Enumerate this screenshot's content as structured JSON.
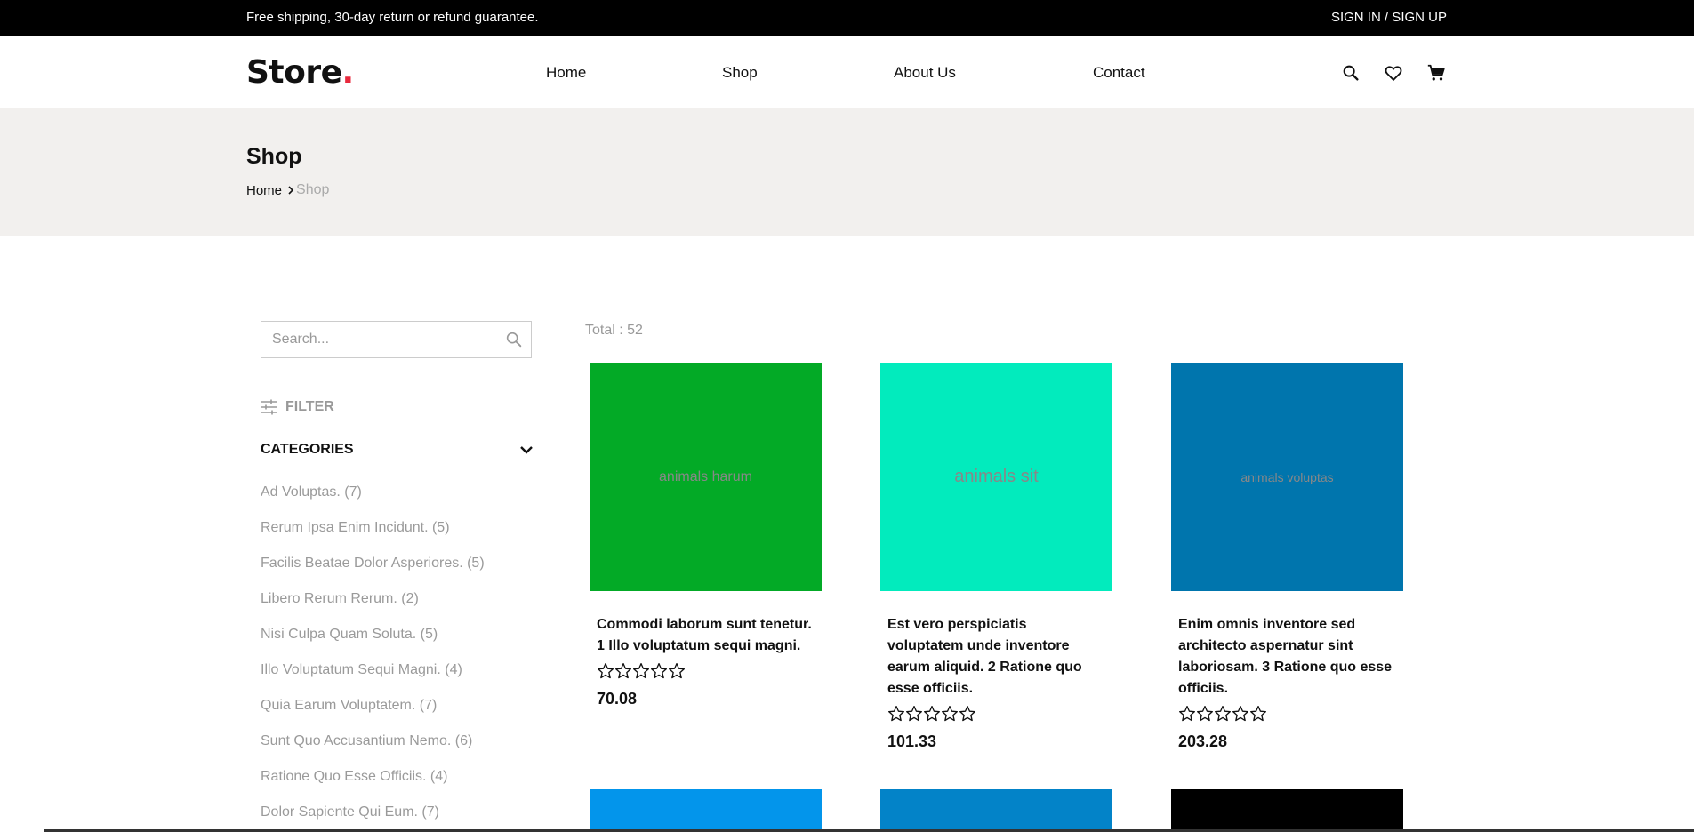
{
  "topbar": {
    "promo": "Free shipping, 30-day return or refund guarantee.",
    "auth": "SIGN IN / SIGN UP"
  },
  "header": {
    "logo_text": "Store",
    "logo_dot": ".",
    "nav": [
      "Home",
      "Shop",
      "About Us",
      "Contact"
    ],
    "icons": [
      "search-icon",
      "heart-icon",
      "cart-icon"
    ]
  },
  "banner": {
    "title": "Shop",
    "breadcrumb": {
      "home": "Home",
      "current": "Shop"
    }
  },
  "sidebar": {
    "search_placeholder": "Search...",
    "filter_label": "FILTER",
    "categories_label": "CATEGORIES",
    "categories": [
      "Ad Voluptas. (7)",
      "Rerum Ipsa Enim Incidunt. (5)",
      "Facilis Beatae Dolor Asperiores. (5)",
      "Libero Rerum Rerum. (2)",
      "Nisi Culpa Quam Soluta. (5)",
      "Illo Voluptatum Sequi Magni. (4)",
      "Quia Earum Voluptatem. (7)",
      "Sunt Quo Accusantium Nemo. (6)",
      "Ratione Quo Esse Officiis. (4)",
      "Dolor Sapiente Qui Eum. (7)"
    ]
  },
  "products": {
    "total": "Total : 52",
    "items": [
      {
        "image_text": "animals harum",
        "color": "#03aa26",
        "title": "Commodi laborum sunt tenetur. 1 Illo voluptatum sequi magni.",
        "rating": 0,
        "price": "70.08"
      },
      {
        "image_text": "animals sit",
        "color": "#02ebbd",
        "title": "Est vero perspiciatis voluptatem unde inventore earum aliquid. 2 Ratione quo esse officiis.",
        "rating": 0,
        "price": "101.33"
      },
      {
        "image_text": "animals voluptas",
        "color": "#0075ad",
        "title": "Enim omnis inventore sed architecto aspernatur sint laboriosam. 3 Ratione quo esse officiis.",
        "rating": 0,
        "price": "203.28"
      }
    ],
    "row2_colors": [
      "#0395eb",
      "#0383c8",
      "#000000"
    ]
  },
  "colors": {
    "accent": "#e8293d",
    "banner_bg": "#f2f0ee"
  }
}
